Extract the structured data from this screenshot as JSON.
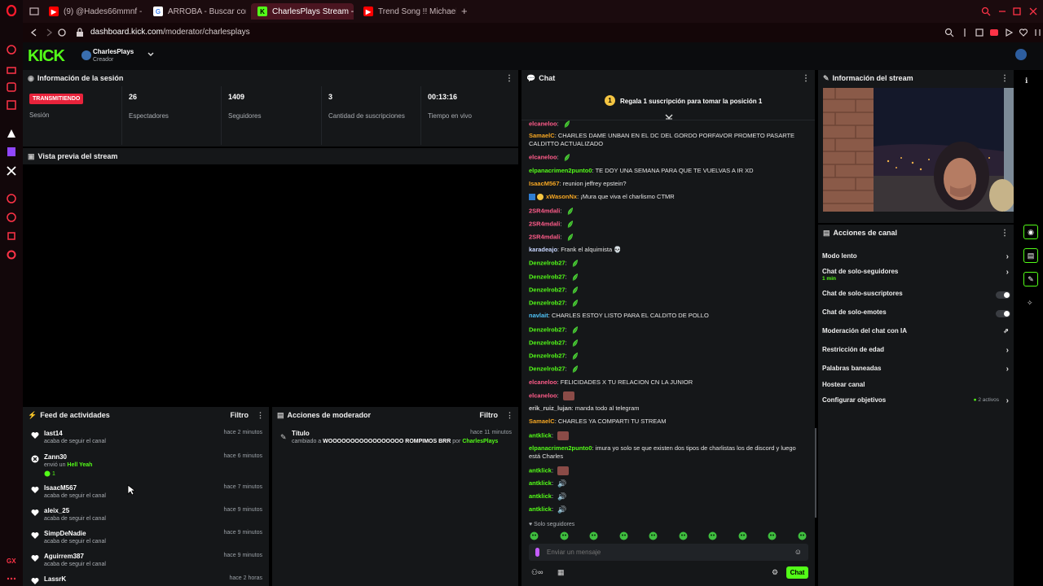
{
  "browser": {
    "tabs": [
      {
        "title": "(9) @Hades66mmnf - De",
        "icon": "youtube-icon"
      },
      {
        "title": "ARROBA - Buscar con Go",
        "icon": "google-icon"
      },
      {
        "title": "CharlesPlays Stream - Ki",
        "icon": "kick-icon",
        "active": true
      },
      {
        "title": "Trend Song !! Michael",
        "icon": "youtube-icon"
      }
    ],
    "new_tab": "+",
    "url_host": "dashboard.kick.com",
    "url_path": "/moderator/charlesplays"
  },
  "kick": {
    "logo": "KICK",
    "channel_name": "CharlesPlays",
    "channel_role": "Creador",
    "accent": "#53fc18"
  },
  "session": {
    "title": "Información de la sesión",
    "live_badge": "TRANSMITIENDO",
    "session_label": "Sesión",
    "stats": [
      {
        "value": "26",
        "label": "Espectadores"
      },
      {
        "value": "1409",
        "label": "Seguidores"
      },
      {
        "value": "3",
        "label": "Cantidad de suscripciones"
      },
      {
        "value": "00:13:16",
        "label": "Tiempo en vivo"
      }
    ]
  },
  "preview": {
    "title": "Vista previa del stream"
  },
  "feed": {
    "title": "Feed de actividades",
    "filter": "Filtro",
    "items": [
      {
        "user": "last14",
        "text": "acaba de seguir el canal",
        "time": "hace 2 minutos"
      },
      {
        "user": "Zann30",
        "text": "envió un",
        "highlight": "Hell Yeah",
        "count": "1",
        "time": "hace 6 minutos"
      },
      {
        "user": "IsaacM567",
        "text": "acaba de seguir el canal",
        "time": "hace 7 minutos"
      },
      {
        "user": "aleix_25",
        "text": "acaba de seguir el canal",
        "time": "hace 9 minutos"
      },
      {
        "user": "SimpDeNadie",
        "text": "acaba de seguir el canal",
        "time": "hace 9 minutos"
      },
      {
        "user": "Aguirrem387",
        "text": "acaba de seguir el canal",
        "time": "hace 9 minutos"
      },
      {
        "user": "LassrK",
        "text": "",
        "time": "hace 2 horas"
      }
    ]
  },
  "modactions": {
    "title": "Acciones de moderador",
    "filter": "Filtro",
    "items": [
      {
        "title": "Título",
        "prefix": "cambiado a",
        "value": "WOOOOOOOOOOOOOOOOO ROMPIMOS BRR",
        "by_label": "por",
        "by": "CharlesPlays",
        "time": "hace 11 minutos"
      }
    ]
  },
  "chat": {
    "title": "Chat",
    "gift_text": "Regala 1 suscripción para tomar la posición 1",
    "gift_rank": "1",
    "messages": [
      {
        "user": "elcaneloo",
        "color": "#ff5c8a",
        "text": "",
        "emote": "leaf"
      },
      {
        "user": "SamaelC",
        "color": "#f5a623",
        "text": "CHARLES DAME UNBAN EN EL DC DEL GORDO PORFAVOR PROMETO PASARTE CALDITTO ACTUALIZADO"
      },
      {
        "user": "elcaneloo",
        "color": "#ff5c8a",
        "text": "",
        "emote": "leaf"
      },
      {
        "user": "elpanacrimen2punto0",
        "color": "#53fc18",
        "text": "TE DOY UNA SEMANA PARA QUE TE VUELVAS A IR XD"
      },
      {
        "user": "IsaacM567",
        "color": "#f5a623",
        "text": "reunion jeffrey epstein?"
      },
      {
        "user": "xWasonNx",
        "color": "#f5a623",
        "text": "¡Mura que viva el charlismo CTMR"
      },
      {
        "user": "2SR4mdali",
        "color": "#ff5c8a",
        "text": "",
        "emote": "leaf"
      },
      {
        "user": "2SR4mdali",
        "color": "#ff5c8a",
        "text": "",
        "emote": "leaf"
      },
      {
        "user": "2SR4mdali",
        "color": "#ff5c8a",
        "text": "",
        "emote": "leaf"
      },
      {
        "user": "karadeajo",
        "color": "#c8d6ff",
        "text": "Frank el alquimista 💀"
      },
      {
        "user": "Denzelrob27",
        "color": "#53fc18",
        "text": "",
        "emote": "leaf"
      },
      {
        "user": "Denzelrob27",
        "color": "#53fc18",
        "text": "",
        "emote": "leaf"
      },
      {
        "user": "Denzelrob27",
        "color": "#53fc18",
        "text": "",
        "emote": "leaf"
      },
      {
        "user": "Denzelrob27",
        "color": "#53fc18",
        "text": "",
        "emote": "leaf"
      },
      {
        "user": "navlait",
        "color": "#4fc3f7",
        "text": "CHARLES ESTOY LISTO PARA EL CALDITO DE POLLO"
      },
      {
        "user": "Denzelrob27",
        "color": "#53fc18",
        "text": "",
        "emote": "leaf"
      },
      {
        "user": "Denzelrob27",
        "color": "#53fc18",
        "text": "",
        "emote": "leaf"
      },
      {
        "user": "Denzelrob27",
        "color": "#53fc18",
        "text": "",
        "emote": "leaf"
      },
      {
        "user": "Denzelrob27",
        "color": "#53fc18",
        "text": "",
        "emote": "leaf"
      },
      {
        "user": "elcaneloo",
        "color": "#ff5c8a",
        "text": "FELICIDADES X TU RELACION CN LA JUNIOR"
      },
      {
        "user": "elcaneloo",
        "color": "#ff5c8a",
        "text": "",
        "emote": "image"
      },
      {
        "user": "erik_ruiz_lujan",
        "color": "#cfcfcf",
        "text": "manda todo al telegram"
      },
      {
        "user": "SamaelC",
        "color": "#f5a623",
        "text": "CHARLES YA COMPARTI TU STREAM"
      },
      {
        "user": "antklick",
        "color": "#53fc18",
        "text": "",
        "emote": "image"
      },
      {
        "user": "elpanacrimen2punto0",
        "color": "#53fc18",
        "text": "imura yo solo se que existen dos tipos de charlistas los de discord y luego está Charles"
      },
      {
        "user": "antklick",
        "color": "#53fc18",
        "text": "",
        "emote": "image"
      },
      {
        "user": "antklick",
        "color": "#53fc18",
        "text": "",
        "emote": "speaker"
      },
      {
        "user": "antklick",
        "color": "#53fc18",
        "text": "",
        "emote": "speaker"
      },
      {
        "user": "antklick",
        "color": "#53fc18",
        "text": "",
        "emote": "speaker"
      }
    ],
    "mode_label": "Solo seguidores",
    "input_placeholder": "Enviar un mensaje",
    "send_label": "Chat"
  },
  "stream_info": {
    "title": "Información del stream"
  },
  "channel_actions": {
    "title": "Acciones de canal",
    "items": [
      {
        "label": "Modo lento",
        "control": "arrow"
      },
      {
        "label": "Chat de solo-seguidores",
        "sub": "1 min",
        "control": "arrow"
      },
      {
        "label": "Chat de solo-suscriptores",
        "control": "toggle"
      },
      {
        "label": "Chat de solo-emotes",
        "control": "toggle"
      },
      {
        "label": "Moderación del chat con IA",
        "control": "external"
      },
      {
        "label": "Restricción de edad",
        "control": "arrow"
      },
      {
        "label": "Palabras baneadas",
        "control": "arrow"
      },
      {
        "label": "Hostear canal",
        "control": "none"
      },
      {
        "label": "Configurar objetivos",
        "badge": "2 activos",
        "control": "arrow"
      }
    ]
  }
}
